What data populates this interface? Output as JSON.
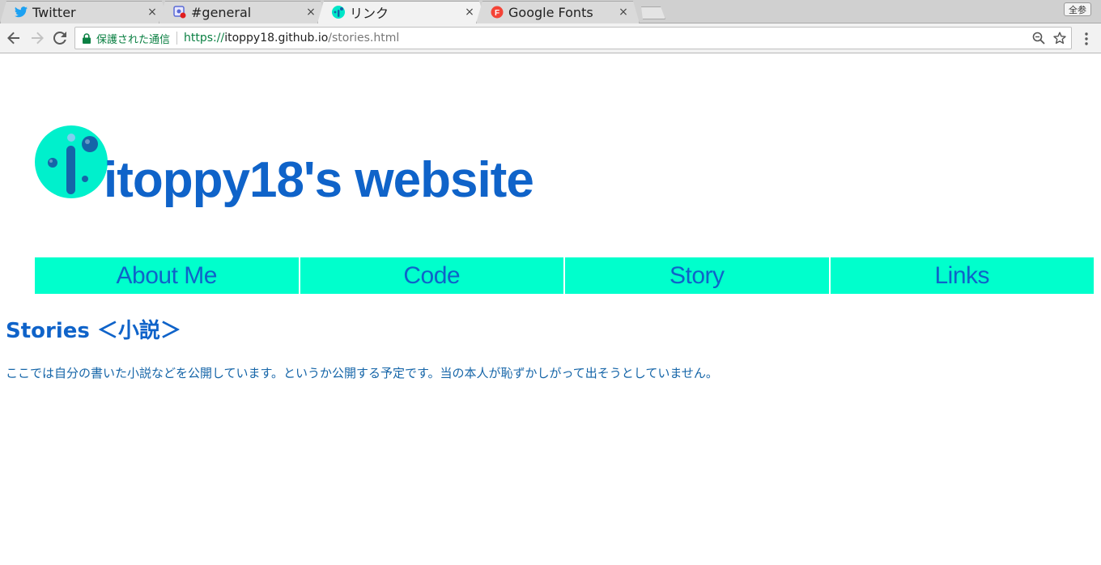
{
  "browser": {
    "tabs": [
      {
        "title": "Twitter",
        "favicon": "twitter-bird-icon",
        "active": false
      },
      {
        "title": "#general",
        "favicon": "slack-notification-icon",
        "active": false
      },
      {
        "title": "リンク",
        "favicon": "itoppy-logo-icon",
        "active": true
      },
      {
        "title": "Google Fonts",
        "favicon": "google-fonts-icon",
        "active": false
      }
    ],
    "close_glyph": "×",
    "profile_label": "全参",
    "omnibox": {
      "secure_label": "保護された通信",
      "url_scheme": "https://",
      "url_host": "itoppy18.github.io",
      "url_path": "/stories.html"
    }
  },
  "site": {
    "title": "itoppy18's website",
    "nav": [
      {
        "label": "About Me"
      },
      {
        "label": "Code"
      },
      {
        "label": "Story"
      },
      {
        "label": "Links"
      }
    ]
  },
  "main": {
    "heading": "Stories ＜小説＞",
    "body": "ここでは自分の書いた小説などを公開しています。というか公開する予定です。当の本人が恥ずかしがって出そうとしていません。"
  },
  "colors": {
    "accent": "#00ffcc",
    "brand_blue": "#0f63c9",
    "body_text": "#1565a8",
    "secure_green": "#0b8043"
  }
}
